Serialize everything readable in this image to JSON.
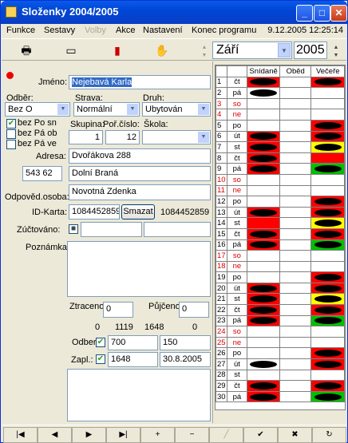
{
  "window": {
    "title": "Složenky 2004/2005"
  },
  "menu": {
    "items": [
      "Funkce",
      "Sestavy",
      "Volby",
      "Akce",
      "Nastavení",
      "Konec programu"
    ],
    "datetime": "9.12.2005 12:25:14"
  },
  "toolbar": {
    "month": "Září",
    "year": "2005",
    "icons": [
      "printer-icon",
      "card-icon",
      "book-icon",
      "hand-icon"
    ]
  },
  "form": {
    "name_label": "Jméno:",
    "name_value": "Nejebavá Karla",
    "odber_label": "Odběr:",
    "odber_value": "Bez O",
    "strava_label": "Strava:",
    "strava_value": "Normální",
    "druh_label": "Druh:",
    "druh_value": "Ubytován",
    "checks": [
      {
        "label": "bez Po sn",
        "checked": true
      },
      {
        "label": "bez Pá ob",
        "checked": false
      },
      {
        "label": "bez Pá ve",
        "checked": false
      }
    ],
    "skupina_label": "Skupina:",
    "skupina_value": "1",
    "porcislo_label": "Poř.číslo:",
    "porcislo_value": "12",
    "skola_label": "Škola:",
    "skola_value": "",
    "adresa_label": "Adresa:",
    "street": "Dvořákova 288",
    "zip": "543 62",
    "city": "Dolní  Braná",
    "osoba_label": "Odpověd.osoba:",
    "osoba_value": "Novotná Zdenka",
    "idkarta_label": "ID-Karta:",
    "idkarta_value": "1084452859",
    "smazat_label": "Smazat",
    "idkarta_readout": "1084452859",
    "zuct_label": "Zúčtováno:",
    "poznamka_label": "Poznámka:",
    "ztraceno_label": "Ztraceno",
    "ztraceno_value": "0",
    "pujceno_label": "Půjčeno",
    "pujceno_value": "0",
    "totals": [
      "0",
      "1119",
      "1648",
      "0"
    ],
    "odber2_label": "Odber:",
    "odber2_value": "700",
    "odber2_right": "150",
    "zapl_label": "Zapl.:",
    "zapl_value": "1648",
    "zapl_date": "30.8.2005"
  },
  "grid": {
    "headers": [
      "",
      "",
      "Snídaně",
      "Oběd",
      "Večeře"
    ],
    "rows": [
      {
        "d": "1",
        "w": "čt",
        "s": "ovR",
        "o": "",
        "v": "ovR"
      },
      {
        "d": "2",
        "w": "pá",
        "s": "ovW",
        "o": "",
        "v": ""
      },
      {
        "d": "3",
        "w": "so",
        "s": "",
        "o": "",
        "v": "",
        "red": true
      },
      {
        "d": "4",
        "w": "ne",
        "s": "",
        "o": "",
        "v": "",
        "red": true
      },
      {
        "d": "5",
        "w": "po",
        "s": "",
        "o": "",
        "v": "ovR"
      },
      {
        "d": "6",
        "w": "út",
        "s": "ovR",
        "o": "",
        "v": "ovR"
      },
      {
        "d": "7",
        "w": "st",
        "s": "ovR",
        "o": "",
        "v": "ovY"
      },
      {
        "d": "8",
        "w": "čt",
        "s": "ovR",
        "o": "",
        "v": "R"
      },
      {
        "d": "9",
        "w": "pá",
        "s": "ovR",
        "o": "",
        "v": "ovG"
      },
      {
        "d": "10",
        "w": "so",
        "s": "",
        "o": "",
        "v": "",
        "red": true
      },
      {
        "d": "11",
        "w": "ne",
        "s": "",
        "o": "",
        "v": "",
        "red": true
      },
      {
        "d": "12",
        "w": "po",
        "s": "",
        "o": "",
        "v": "ovR"
      },
      {
        "d": "13",
        "w": "út",
        "s": "ovR",
        "o": "",
        "v": "ovR"
      },
      {
        "d": "14",
        "w": "st",
        "s": "R",
        "o": "",
        "v": "ovY"
      },
      {
        "d": "15",
        "w": "čt",
        "s": "ovR",
        "o": "",
        "v": "ovR"
      },
      {
        "d": "16",
        "w": "pá",
        "s": "ovR",
        "o": "",
        "v": "ovG"
      },
      {
        "d": "17",
        "w": "so",
        "s": "",
        "o": "",
        "v": "",
        "red": true
      },
      {
        "d": "18",
        "w": "ne",
        "s": "",
        "o": "",
        "v": "",
        "red": true
      },
      {
        "d": "19",
        "w": "po",
        "s": "",
        "o": "",
        "v": "ovR"
      },
      {
        "d": "20",
        "w": "út",
        "s": "ovR",
        "o": "",
        "v": "ovR"
      },
      {
        "d": "21",
        "w": "st",
        "s": "ovR",
        "o": "",
        "v": "ovY"
      },
      {
        "d": "22",
        "w": "čt",
        "s": "ovR",
        "o": "",
        "v": "ovR"
      },
      {
        "d": "23",
        "w": "pá",
        "s": "ovR",
        "o": "",
        "v": "ovG"
      },
      {
        "d": "24",
        "w": "so",
        "s": "",
        "o": "",
        "v": "",
        "red": true
      },
      {
        "d": "25",
        "w": "ne",
        "s": "",
        "o": "",
        "v": "",
        "red": true
      },
      {
        "d": "26",
        "w": "po",
        "s": "",
        "o": "",
        "v": "ovR"
      },
      {
        "d": "27",
        "w": "út",
        "s": "ovW",
        "o": "",
        "v": "ovR"
      },
      {
        "d": "28",
        "w": "st",
        "s": "",
        "o": "",
        "v": ""
      },
      {
        "d": "29",
        "w": "čt",
        "s": "ovR",
        "o": "",
        "v": "ovR"
      },
      {
        "d": "30",
        "w": "pá",
        "s": "ovR",
        "o": "",
        "v": "ovG"
      }
    ]
  },
  "nav": {
    "buttons": [
      "|◀",
      "◀",
      "▶",
      "▶|",
      "+",
      "−",
      "╱",
      "✔",
      "✖",
      "↻"
    ]
  },
  "colors": {
    "red": "#ff0000",
    "yellow": "#ffff00",
    "green": "#00c000",
    "weekend": "#dd0000"
  }
}
